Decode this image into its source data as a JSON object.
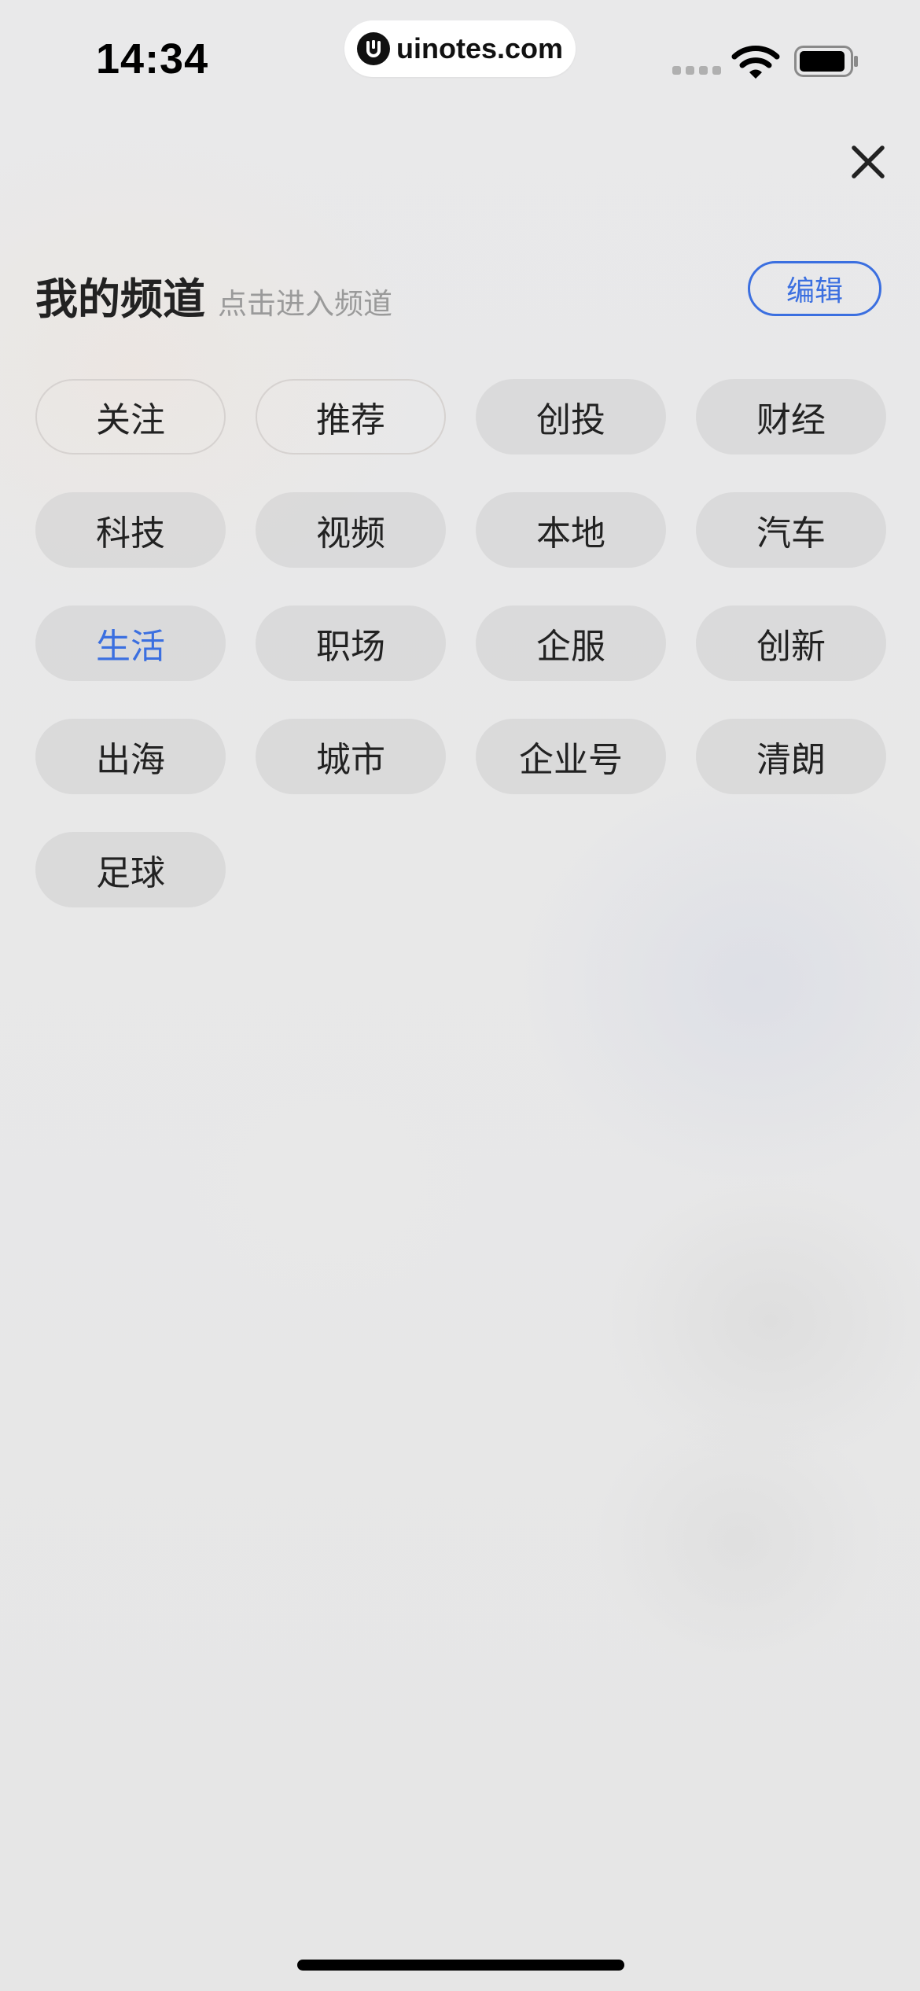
{
  "status_bar": {
    "time": "14:34",
    "url": "uinotes.com"
  },
  "header": {
    "title": "我的频道",
    "subtitle": "点击进入频道",
    "edit_label": "编辑"
  },
  "channels": [
    {
      "label": "关注",
      "style": "outlined"
    },
    {
      "label": "推荐",
      "style": "outlined"
    },
    {
      "label": "创投",
      "style": "filled"
    },
    {
      "label": "财经",
      "style": "filled"
    },
    {
      "label": "科技",
      "style": "filled"
    },
    {
      "label": "视频",
      "style": "filled"
    },
    {
      "label": "本地",
      "style": "filled"
    },
    {
      "label": "汽车",
      "style": "filled"
    },
    {
      "label": "生活",
      "style": "active"
    },
    {
      "label": "职场",
      "style": "filled"
    },
    {
      "label": "企服",
      "style": "filled"
    },
    {
      "label": "创新",
      "style": "filled"
    },
    {
      "label": "出海",
      "style": "filled"
    },
    {
      "label": "城市",
      "style": "filled"
    },
    {
      "label": "企业号",
      "style": "filled"
    },
    {
      "label": "清朗",
      "style": "filled"
    },
    {
      "label": "足球",
      "style": "filled"
    }
  ],
  "colors": {
    "accent": "#3b6fe0",
    "text": "#222222",
    "muted": "#9a9a9a"
  },
  "icons": {
    "close": "close-icon",
    "wifi": "wifi-icon",
    "battery": "battery-icon",
    "signal": "signal-icon",
    "logo": "uinotes-logo-icon"
  }
}
